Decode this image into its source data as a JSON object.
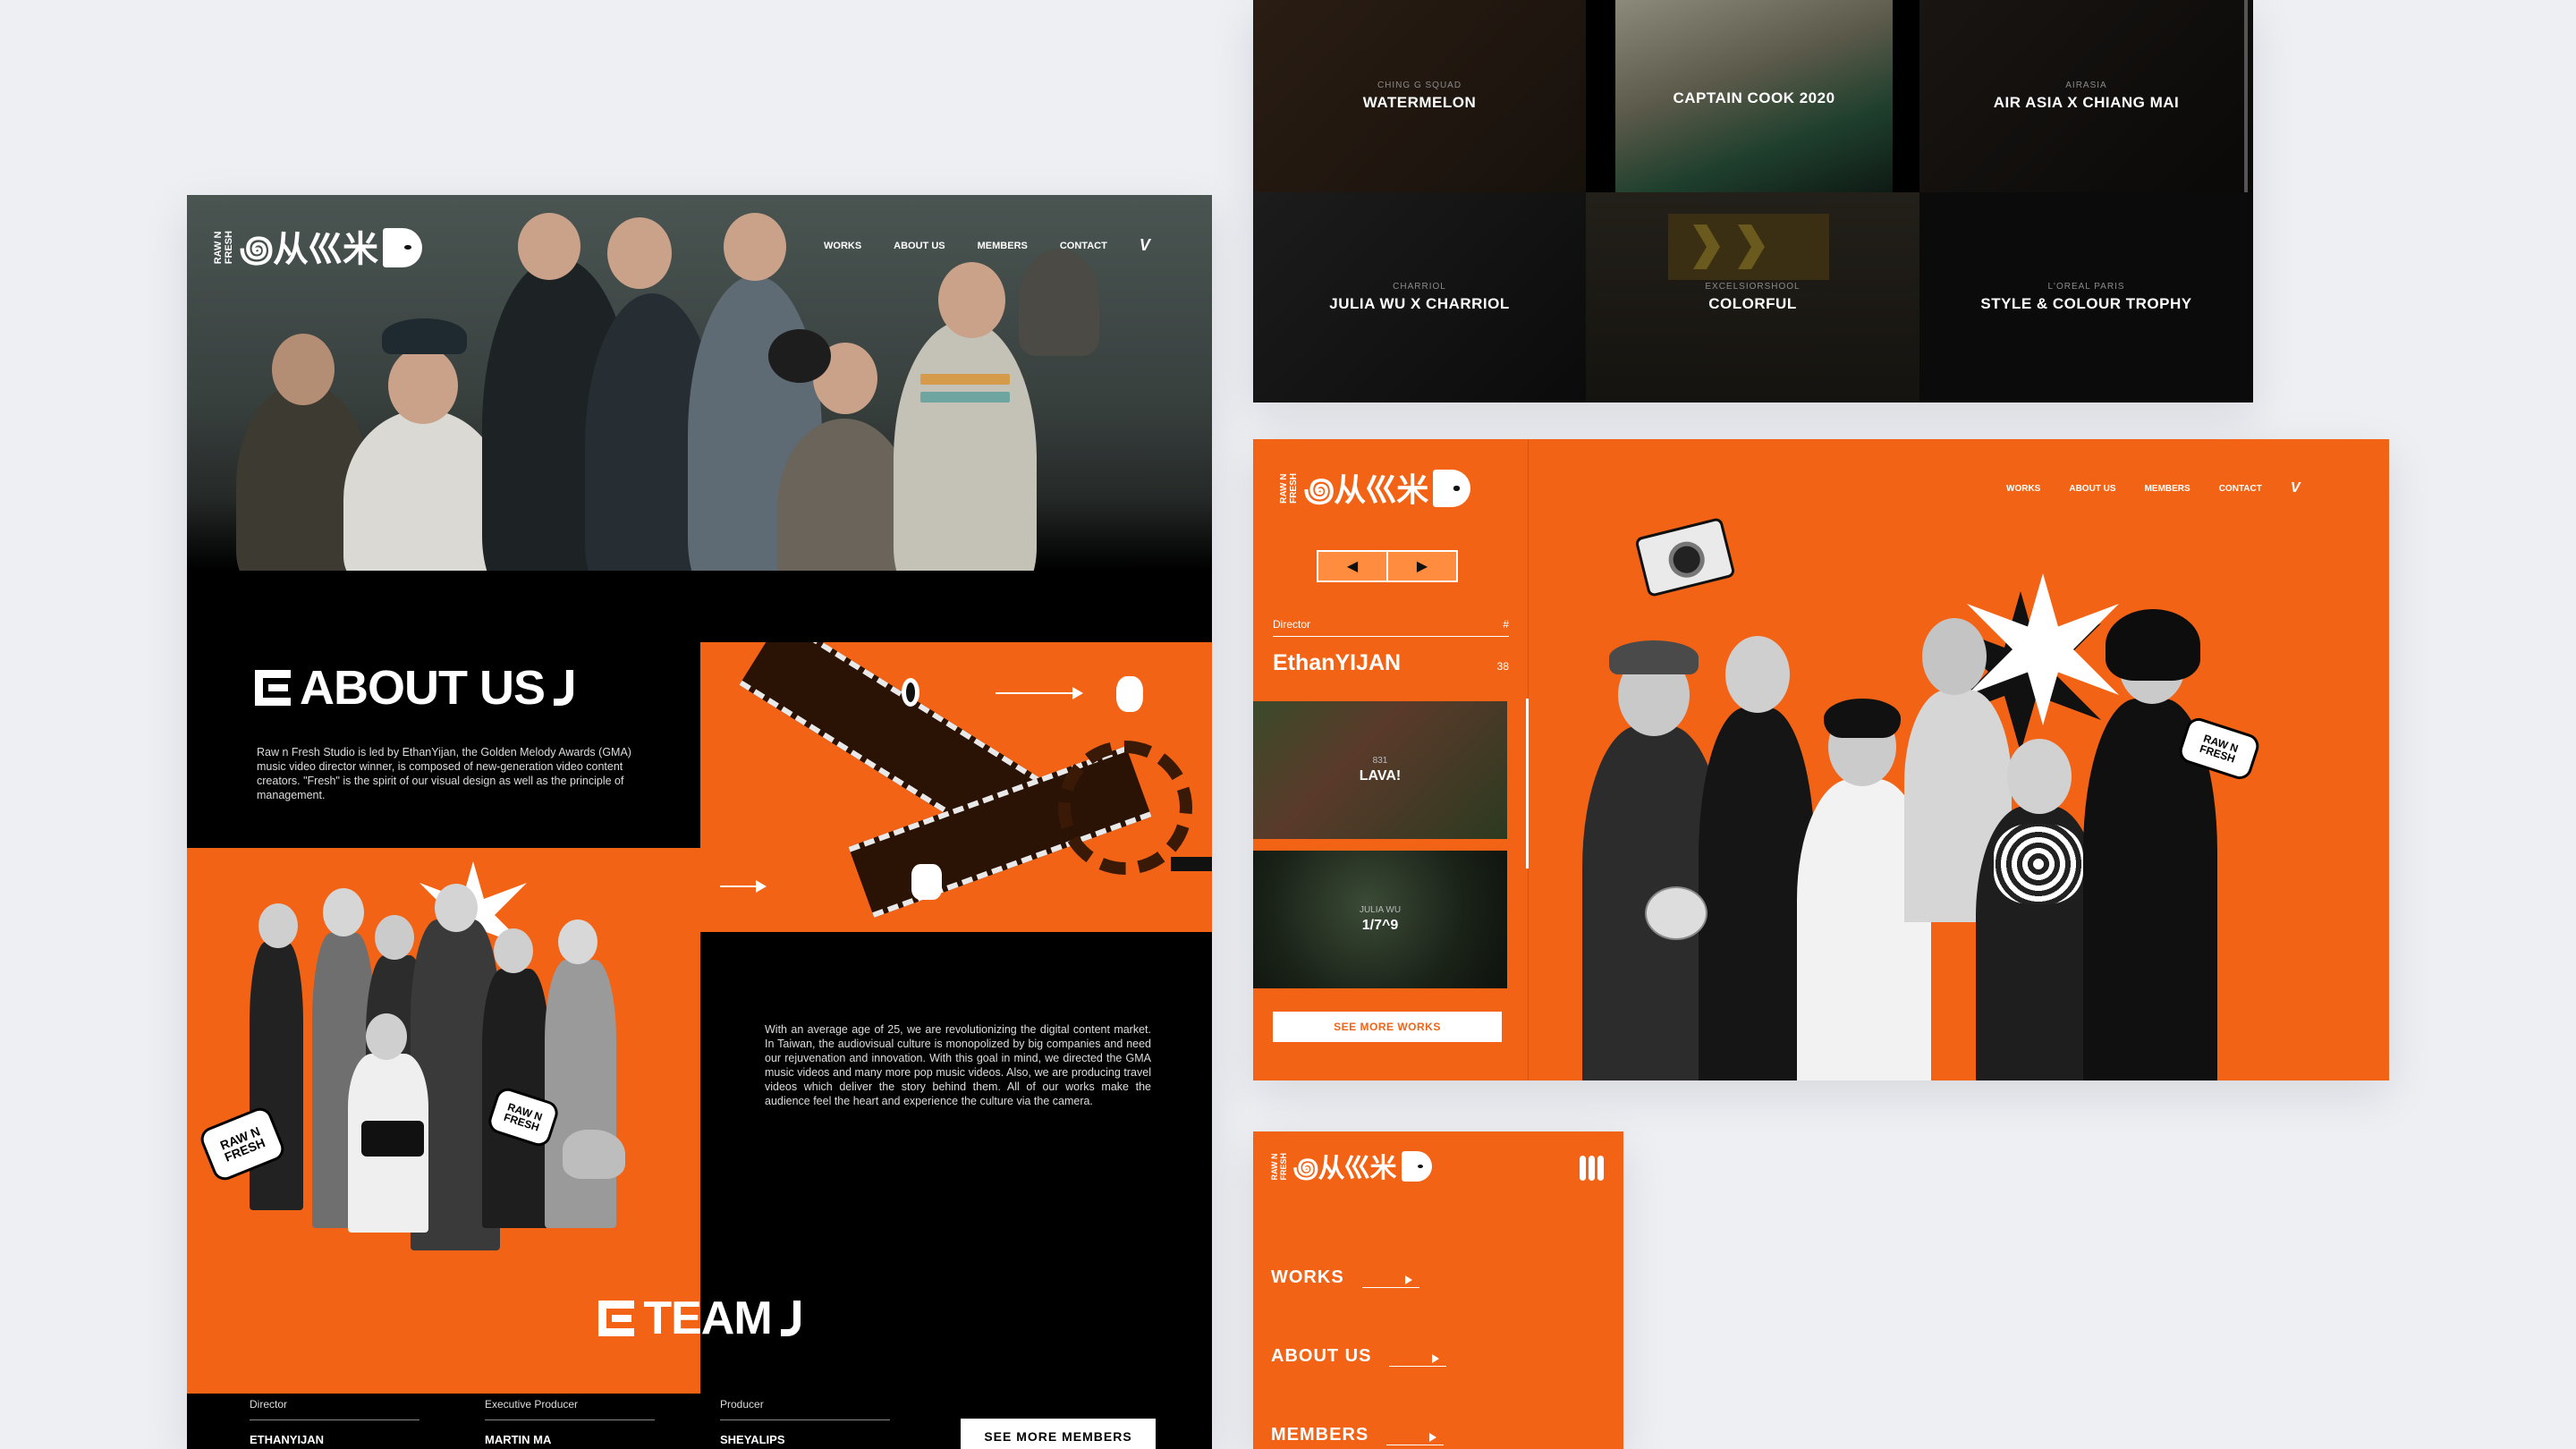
{
  "brand": {
    "logo_text_1": "RAW N",
    "logo_text_2": "FRESH",
    "logo_glyphs": "꩜从巛米",
    "accent": "#f26316",
    "dark": "#050505"
  },
  "nav": {
    "items": [
      "WORKS",
      "ABOUT US",
      "MEMBERS",
      "CONTACT"
    ],
    "vimeo": "V",
    "vimeo_icon": "vimeo-icon"
  },
  "about": {
    "title": "ABOUT US",
    "p1": "Raw n Fresh Studio is led by EthanYijan, the Golden Melody Awards (GMA) music video director winner, is composed of new-generation video content creators. \"Fresh\" is the spirit of our visual design as well as the principle of management.",
    "p2": "With an average age of 25, we are revolutionizing the digital content market. In Taiwan, the audiovisual culture is monopolized by big companies and need our rejuvenation and innovation. With this goal in mind, we directed the GMA music videos and many more pop music videos. Also, we are producing travel videos which deliver the story behind them. All of our works make the audience feel the heart and experience the culture via the camera.",
    "sticker_1": "RAW N FRESH",
    "sticker_2": "RAW N FRESH"
  },
  "team": {
    "title": "TEAM",
    "members": [
      {
        "role": "Director",
        "name": "ETHANYIJAN"
      },
      {
        "role": "Executive Producer",
        "name": "MARTIN MA"
      },
      {
        "role": "Producer",
        "name": "SHEYALIPS"
      }
    ],
    "see_more": "SEE MORE MEMBERS"
  },
  "works_grid": [
    {
      "client": "CHING G SQUAD",
      "title": "WATERMELON"
    },
    {
      "client": "",
      "title": "CAPTAIN COOK 2020"
    },
    {
      "client": "AIRASIA",
      "title": "AIR ASIA X CHIANG MAI"
    },
    {
      "client": "CHARRIOL",
      "title": "JULIA WU X CHARRIOL"
    },
    {
      "client": "EXCELSIORSHOOL",
      "title": "COLORFUL"
    },
    {
      "client": "L'OREAL PARIS",
      "title": "STYLE & COLOUR TROPHY"
    }
  ],
  "director_page": {
    "pager_prev": "◀",
    "pager_next": "▶",
    "label": "Director",
    "hash": "#",
    "name": "EthanYIJAN",
    "count": "38",
    "works": [
      {
        "client": "831",
        "title": "LAVA!"
      },
      {
        "client": "JULIA WU",
        "title": "1/7^9"
      }
    ],
    "see_more": "SEE MORE WORKS",
    "sticker": "RAW N FRESH"
  },
  "mobile_menu": {
    "items": [
      "WORKS",
      "ABOUT US",
      "MEMBERS"
    ]
  }
}
